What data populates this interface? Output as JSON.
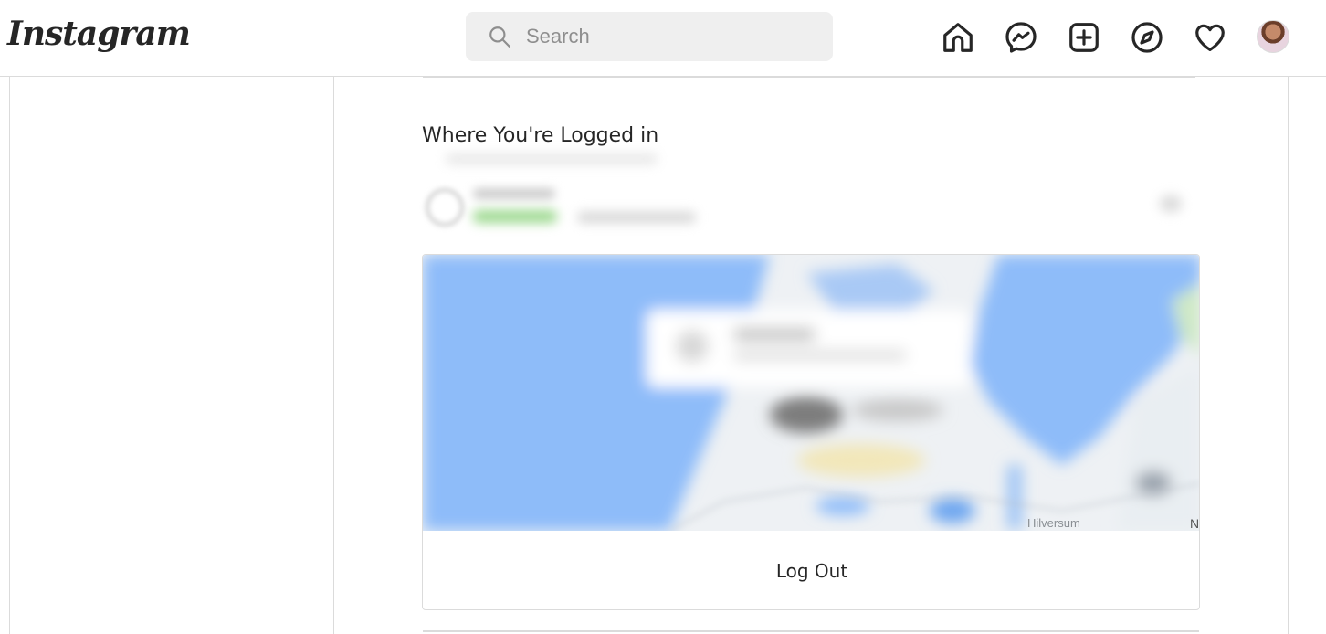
{
  "topbar": {
    "logo": "Instagram",
    "search": {
      "placeholder": "Search"
    }
  },
  "nav_icons": [
    "home-icon",
    "messenger-icon",
    "new-post-icon",
    "explore-icon",
    "activity-heart-icon",
    "profile-avatar"
  ],
  "section": {
    "title": "Where You're Logged in"
  },
  "map": {
    "labels": [
      "Hilversum",
      "N"
    ]
  },
  "card": {
    "logout_label": "Log Out"
  },
  "colors": {
    "water": "#8ebcf9",
    "border": "#dbdbdb",
    "text": "#262626",
    "placeholder": "#8e8e8e",
    "search_bg": "#efefef"
  }
}
